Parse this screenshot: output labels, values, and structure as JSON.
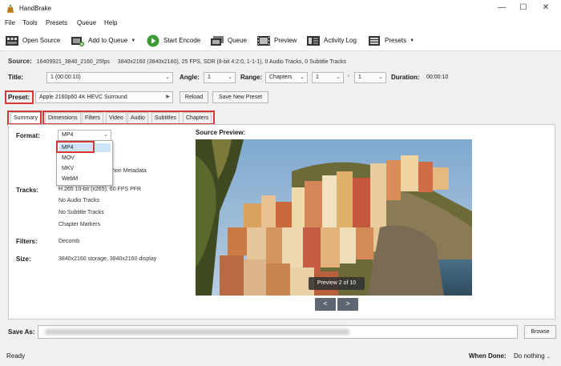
{
  "app": {
    "title": "HandBrake"
  },
  "window_controls": {
    "minimize": "—",
    "maximize": "☐",
    "close": "✕"
  },
  "menu": [
    "File",
    "Tools",
    "Presets",
    "Queue",
    "Help"
  ],
  "toolbar": {
    "open_source": "Open Source",
    "add_to_queue": "Add to Queue",
    "start_encode": "Start Encode",
    "queue": "Queue",
    "preview": "Preview",
    "activity_log": "Activity Log",
    "presets": "Presets"
  },
  "source": {
    "label": "Source:",
    "name": "16409921_3840_2160_25fps",
    "details": "3840x2160 (3840x2160), 25 FPS, SDR (8-bit 4:2:0, 1-1-1), 0 Audio Tracks, 0 Subtitle Tracks"
  },
  "title_row": {
    "title_label": "Title:",
    "title_value": "1 (00:00:10)",
    "angle_label": "Angle:",
    "angle_value": "1",
    "range_label": "Range:",
    "range_mode": "Chapters",
    "range_start": "1",
    "range_sep": "-",
    "range_end": "1",
    "duration_label": "Duration:",
    "duration_value": "00:00:10"
  },
  "preset_row": {
    "label": "Preset:",
    "value": "Apple 2160p60 4K HEVC Surround",
    "reload": "Reload",
    "save_new": "Save New Preset"
  },
  "tabs": [
    "Summary",
    "Dimensions",
    "Filters",
    "Video",
    "Audio",
    "Subtitles",
    "Chapters"
  ],
  "summary": {
    "format_label": "Format:",
    "format_value": "MP4",
    "format_options": [
      "MP4",
      "MOV",
      "MKV",
      "WebM"
    ],
    "metadata_text": "hon Metadata",
    "tracks_label": "Tracks:",
    "tracks": [
      "H.265 10-bit (x265), 60 FPS PFR",
      "No Audio Tracks",
      "No Subtitle Tracks",
      "Chapter Markers"
    ],
    "filters_label": "Filters:",
    "filters_value": "Decomb",
    "size_label": "Size:",
    "size_value": "3840x2160 storage, 3840x2160 display",
    "source_preview_label": "Source Preview:",
    "preview_badge": "Preview 2 of 10",
    "prev_btn": "<",
    "next_btn": ">"
  },
  "save_as": {
    "label": "Save As:",
    "browse": "Browse"
  },
  "status": {
    "ready": "Ready",
    "when_done_label": "When Done:",
    "when_done_value": "Do nothing"
  },
  "colors": {
    "highlight": "#d63838",
    "selected_option": "#cce4f7",
    "nav_button": "#5d6672"
  },
  "icons": {
    "app": "pineapple-icon",
    "open_source": "film-strip-icon",
    "add_to_queue": "add-queue-icon",
    "start_encode": "play-icon",
    "queue": "queue-icon",
    "preview": "preview-film-icon",
    "activity_log": "log-icon",
    "presets": "presets-icon"
  }
}
